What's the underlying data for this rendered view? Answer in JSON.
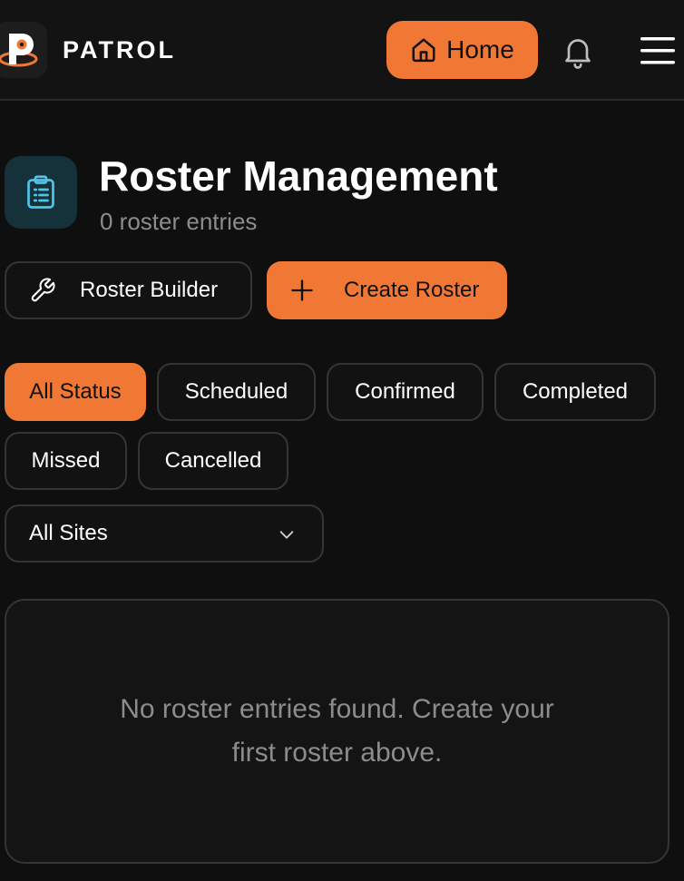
{
  "header": {
    "brand": "PATROL",
    "home_label": "Home"
  },
  "title_section": {
    "title": "Roster Management",
    "subtitle": "0 roster entries"
  },
  "actions": {
    "roster_builder_label": "Roster Builder",
    "create_roster_label": "Create Roster"
  },
  "filters": {
    "status_chips": [
      {
        "label": "All Status",
        "active": true
      },
      {
        "label": "Scheduled",
        "active": false
      },
      {
        "label": "Confirmed",
        "active": false
      },
      {
        "label": "Completed",
        "active": false
      },
      {
        "label": "Missed",
        "active": false
      },
      {
        "label": "Cancelled",
        "active": false
      }
    ],
    "site_select_value": "All Sites"
  },
  "empty_state": {
    "message": "No roster entries found. Create your first roster above."
  },
  "icons": {
    "logo": "patrol-logo-icon",
    "home": "home-icon",
    "notifications": "bell-icon",
    "menu": "hamburger-menu-icon",
    "title": "clipboard-list-icon",
    "roster_builder": "wrench-icon",
    "create_roster": "plus-icon",
    "select": "chevron-down-icon"
  },
  "colors": {
    "accent": "#f07834",
    "background": "#0f0f0f",
    "icon_tile": "#15323a",
    "icon_tint": "#4fc3e8",
    "muted_text": "#8c8c8c",
    "border": "#353535"
  }
}
